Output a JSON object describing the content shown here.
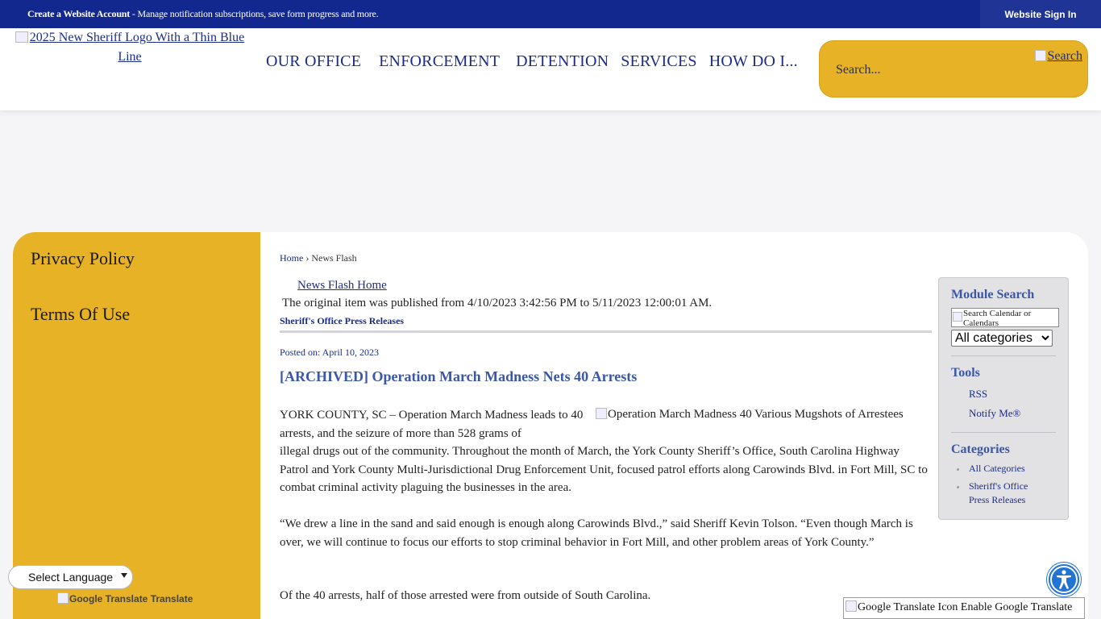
{
  "topbar": {
    "create_account": "Create a Website Account",
    "message": " - Manage notification subscriptions, save form progress and more.",
    "sign_in": "Website Sign In"
  },
  "header": {
    "logo_alt_line1": "2025 New Sheriff Logo With a Thin Blue",
    "logo_alt_line2": "Line",
    "nav": [
      "OUR OFFICE",
      "ENFORCEMENT",
      "DETENTION",
      "SERVICES",
      "HOW DO I..."
    ],
    "search_placeholder": "Search...",
    "search_button": "Search"
  },
  "left_column": {
    "links": [
      "Privacy Policy",
      "Terms Of Use"
    ]
  },
  "breadcrumb": {
    "home": "Home",
    "separator": " › ",
    "current": "News Flash"
  },
  "article": {
    "news_flash_home": "News Flash Home",
    "original_notice": "The original item was published from 4/10/2023 3:42:56 PM to 5/11/2023 12:00:01 AM.",
    "category": "Sheriff's Office Press Releases",
    "posted_on": "Posted on: April 10, 2023",
    "title": "[ARCHIVED] Operation March Madness Nets 40 Arrests",
    "image_alt": "Operation March Madness 40 Various Mugshots of Arrestees",
    "p1_start": "YORK COUNTY, SC – Operation March Madness leads to 40 arrests, and the seizure of more than 528 grams of",
    "p1_rest": "illegal drugs out of the community. Throughout the month of March, the York County Sheriff’s Office, South Carolina Highway Patrol and York County Multi-Jurisdictional Drug Enforcement Unit, focused patrol efforts along Carowinds Blvd. in Fort Mill, SC to combat criminal activity plaguing the businesses in the area.",
    "p2": "“We drew a line in the sand and said enough is enough along Carowinds Blvd.,” said Sheriff Kevin Tolson. “Even though March is over, we will continue to focus our efforts to stop criminal behavior in Fort Mill, and other problem areas of York County.”",
    "p3": "Of the 40 arrests, half of those arrested were from outside of South Carolina."
  },
  "sidebar": {
    "module_search_title": "Module Search",
    "search_field_text": "Search Calendar or Calendars",
    "category_select": "All categories",
    "tools_title": "Tools",
    "tools": [
      "RSS",
      "Notify Me®"
    ],
    "categories_title": "Categories",
    "categories": [
      "All Categories",
      "Sheriff's Office Press Releases"
    ]
  },
  "translate": {
    "select_language": "Select Language",
    "google_translate": "Google Translate Translate",
    "enable": "Google Translate Icon Enable Google Translate"
  },
  "colors": {
    "topbar": "#13288f",
    "accent_gold": "#e7b225",
    "link_blue": "#1b2d86",
    "title_blue": "#3a57a8"
  }
}
